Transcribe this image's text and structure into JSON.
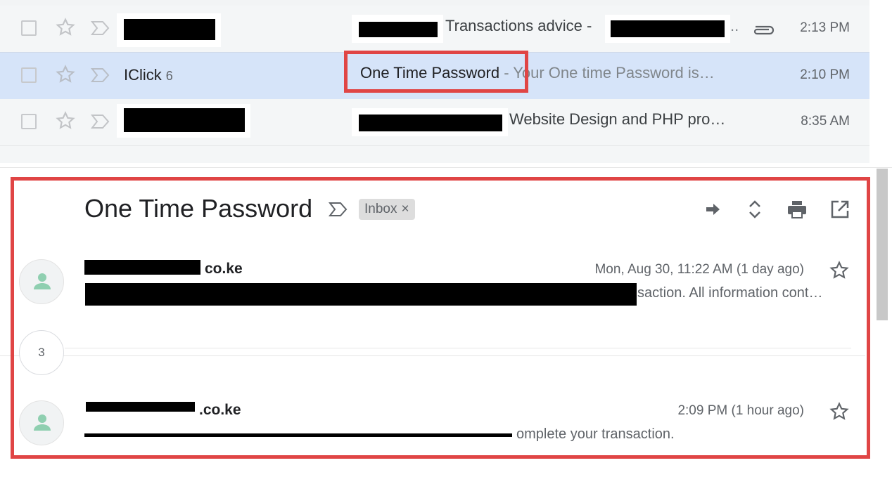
{
  "inbox": {
    "rows": [
      {
        "sender": "",
        "subject": "Transactions advice -",
        "preview": "..",
        "time": "2:13 PM",
        "has_attachment": true
      },
      {
        "sender": "IClick",
        "sender_count": "6",
        "subject": "One Time Password",
        "preview": " - Your One time Password is…",
        "time": "2:10 PM",
        "selected": true
      },
      {
        "sender": "",
        "subject": "",
        "preview": "Website Design and PHP pro…",
        "time": "8:35 AM"
      }
    ]
  },
  "conversation": {
    "title": "One Time Password",
    "label_chip": "Inbox",
    "label_chip_remove": "×",
    "collapsed_count": "3",
    "messages": [
      {
        "from_domain": "co.ke",
        "time": "Mon, Aug 30, 11:22 AM (1 day ago)",
        "snippet": "saction. All information cont…"
      },
      {
        "from_domain": ".co.ke",
        "time": "2:09 PM (1 hour ago)",
        "snippet": "omplete your transaction."
      }
    ]
  },
  "icons": [
    "checkbox",
    "star-icon",
    "important-marker-icon",
    "attachment-icon",
    "forward-arrow-icon",
    "expand-collapse-icon",
    "print-icon",
    "open-in-new-window-icon",
    "person-avatar-icon"
  ],
  "colors": {
    "highlight_border": "#e04545",
    "selected_row": "#d6e4f9",
    "avatar_person": "#8fcfb0"
  }
}
